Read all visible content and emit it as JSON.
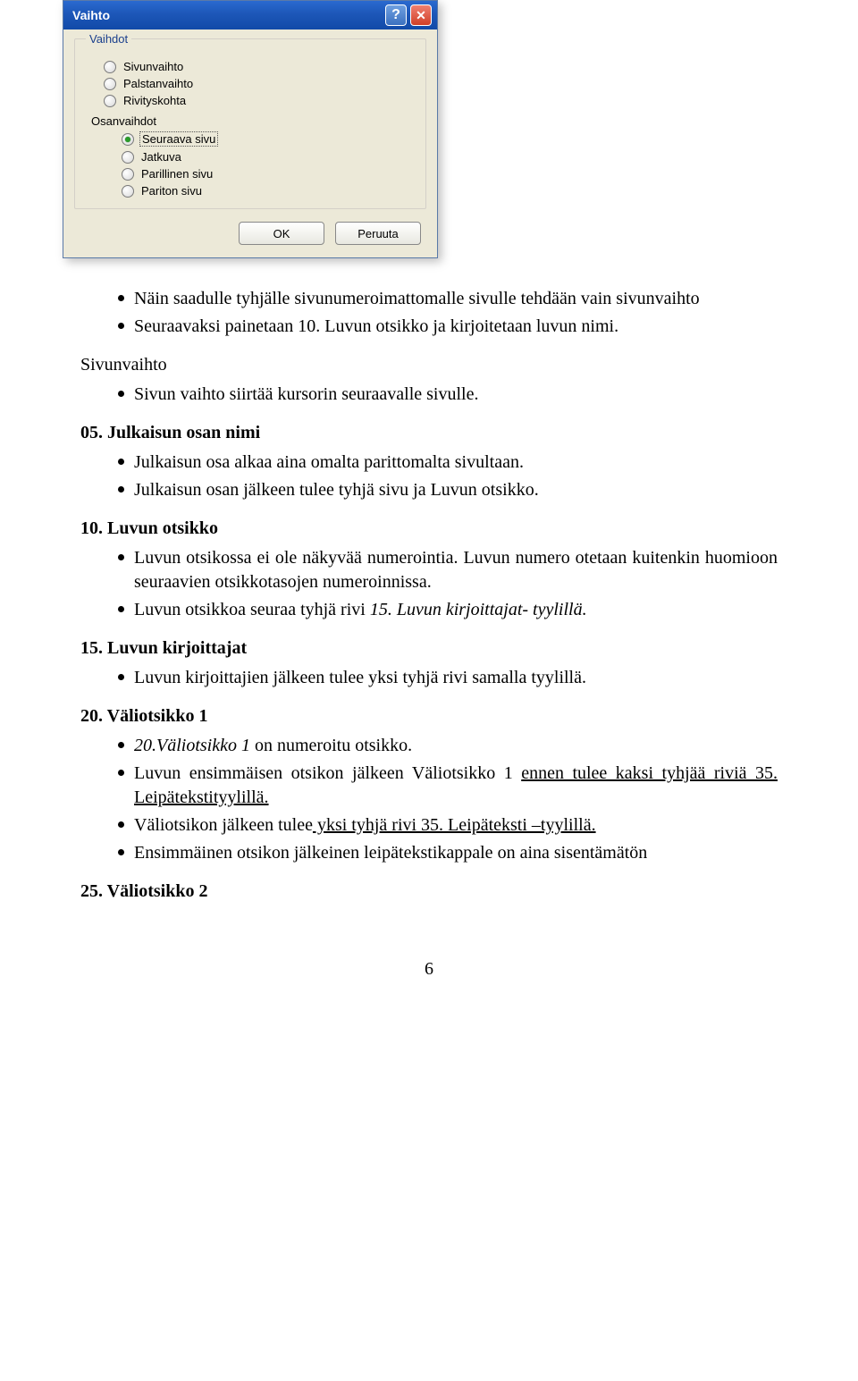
{
  "dialog": {
    "title": "Vaihto",
    "help_aria": "Ohje",
    "close_aria": "Sulje",
    "legend": "Vaihdot",
    "subhead": "Osanvaihdot",
    "options_a": [
      {
        "label": "Sivunvaihto"
      },
      {
        "label": "Palstanvaihto"
      },
      {
        "label": "Rivityskohta"
      }
    ],
    "options_b": [
      {
        "label": "Seuraava sivu",
        "checked": true
      },
      {
        "label": "Jatkuva"
      },
      {
        "label": "Parillinen sivu"
      },
      {
        "label": "Pariton sivu"
      }
    ],
    "ok": "OK",
    "cancel": "Peruuta"
  },
  "doc": {
    "top_bullets": [
      "Näin saadulle tyhjälle sivunumeroimattomalle sivulle tehdään vain sivunvaihto",
      "Seuraavaksi painetaan 10. Luvun otsikko ja kirjoitetaan luvun nimi."
    ],
    "sec1_title": "Sivunvaihto",
    "sec1_bullets": [
      "Sivun vaihto siirtää kursorin seuraavalle sivulle."
    ],
    "sec2_title": "05. Julkaisun osan nimi",
    "sec2_bullets": [
      "Julkaisun osa alkaa aina omalta parittomalta sivultaan.",
      "Julkaisun osan jälkeen tulee tyhjä sivu ja Luvun otsikko."
    ],
    "sec3_title": "10. Luvun otsikko",
    "sec3_b1": "Luvun otsikossa ei ole näkyvää numerointia. Luvun numero otetaan kuitenkin huomioon seuraavien otsikkotasojen numeroinnissa.",
    "sec3_b2a": "Luvun otsikkoa seuraa tyhjä rivi ",
    "sec3_b2b": "15. Luvun kirjoittajat- tyylillä.",
    "sec4_title": "15. Luvun kirjoittajat",
    "sec4_bullets": [
      "Luvun kirjoittajien jälkeen tulee yksi tyhjä rivi samalla tyylillä."
    ],
    "sec5_title": "20. Väliotsikko 1",
    "sec5_b1a": "20.Väliotsikko 1",
    "sec5_b1b": " on numeroitu otsikko.",
    "sec5_b2a": "Luvun ensimmäisen otsikon jälkeen Väliotsikko 1 ",
    "sec5_b2b": "ennen tulee kaksi tyhjää riviä 35. Leipätekstityylillä.",
    "sec5_b3a": "Väliotsikon jälkeen tulee",
    "sec5_b3b": " yksi tyhjä rivi 35. Leipäteksti –tyylillä.",
    "sec5_b4": "Ensimmäinen otsikon jälkeinen leipätekstikappale on aina sisentämätön",
    "sec6_title": "25. Väliotsikko 2",
    "page_number": "6"
  }
}
